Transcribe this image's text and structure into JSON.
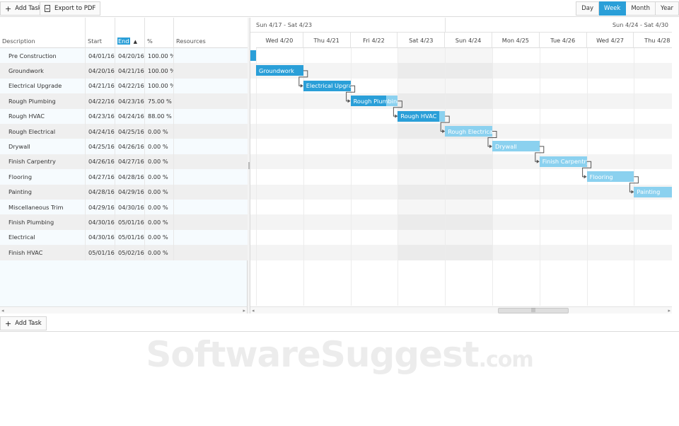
{
  "toolbar": {
    "add_task": "Add Task",
    "export_pdf": "Export to PDF",
    "views": [
      "Day",
      "Week",
      "Month",
      "Year"
    ],
    "active_view": "Week"
  },
  "columns": {
    "description": "Description",
    "start": "Start",
    "end": "End",
    "percent": "%",
    "resources": "Resources"
  },
  "tasks": [
    {
      "name": "Pre Construction",
      "start": "04/01/16",
      "end": "04/20/16",
      "pct": "100.00 %"
    },
    {
      "name": "Groundwork",
      "start": "04/20/16",
      "end": "04/21/16",
      "pct": "100.00 %"
    },
    {
      "name": "Electrical Upgrade",
      "start": "04/21/16",
      "end": "04/22/16",
      "pct": "100.00 %"
    },
    {
      "name": "Rough Plumbing",
      "start": "04/22/16",
      "end": "04/23/16",
      "pct": "75.00 %"
    },
    {
      "name": "Rough HVAC",
      "start": "04/23/16",
      "end": "04/24/16",
      "pct": "88.00 %"
    },
    {
      "name": "Rough Electrical",
      "start": "04/24/16",
      "end": "04/25/16",
      "pct": "0.00 %"
    },
    {
      "name": "Drywall",
      "start": "04/25/16",
      "end": "04/26/16",
      "pct": "0.00 %"
    },
    {
      "name": "Finish Carpentry",
      "start": "04/26/16",
      "end": "04/27/16",
      "pct": "0.00 %"
    },
    {
      "name": "Flooring",
      "start": "04/27/16",
      "end": "04/28/16",
      "pct": "0.00 %"
    },
    {
      "name": "Painting",
      "start": "04/28/16",
      "end": "04/29/16",
      "pct": "0.00 %"
    },
    {
      "name": "Miscellaneous Trim",
      "start": "04/29/16",
      "end": "04/30/16",
      "pct": "0.00 %"
    },
    {
      "name": "Finish Plumbing",
      "start": "04/30/16",
      "end": "05/01/16",
      "pct": "0.00 %"
    },
    {
      "name": "Electrical",
      "start": "04/30/16",
      "end": "05/01/16",
      "pct": "0.00 %"
    },
    {
      "name": "Finish HVAC",
      "start": "05/01/16",
      "end": "05/02/16",
      "pct": "0.00 %"
    }
  ],
  "timeline": {
    "weeks": [
      "Sun 4/17 - Sat 4/23",
      "Sun 4/24 - Sat 4/30"
    ],
    "days": [
      "Wed 4/20",
      "Thu 4/21",
      "Fri 4/22",
      "Sat 4/23",
      "Sun 4/24",
      "Mon 4/25",
      "Tue 4/26",
      "Wed 4/27",
      "Thu 4/28"
    ],
    "bar_labels": [
      "",
      "Groundwork",
      "Electrical Upgrade",
      "Rough Plumbing",
      "Rough HVAC",
      "Rough Electrical",
      "Drywall",
      "Finish Carpentry",
      "Flooring",
      "Painting"
    ],
    "progress": [
      1.0,
      1.0,
      1.0,
      0.75,
      0.88,
      0,
      0,
      0,
      0,
      0
    ]
  },
  "bottom": {
    "add_task": "Add Task"
  },
  "watermark": {
    "main": "SoftwareSuggest",
    "domain": ".com"
  },
  "colors": {
    "accent": "#2a9fd8",
    "bar_light": "#8bd1ef"
  }
}
